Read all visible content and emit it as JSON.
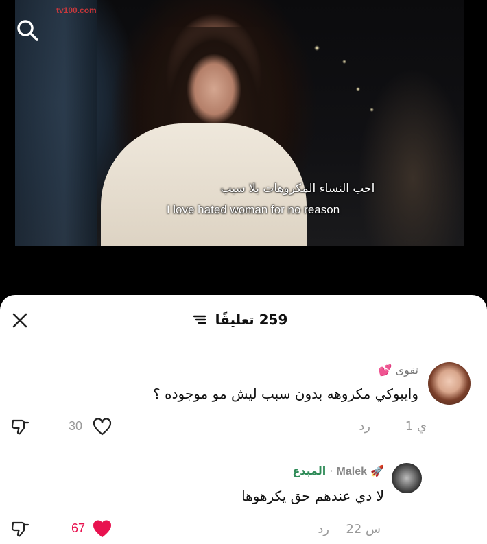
{
  "video": {
    "watermark": "tv100.com",
    "subtitle_ar": "احب النساء المكروهات بلا سبب",
    "subtitle_en": "I love hated woman for no reason"
  },
  "sheet": {
    "count": "259",
    "title_word": "تعليقًا"
  },
  "comments": [
    {
      "author": "تقوى",
      "author_emoji": "💕",
      "text": "وايبوكي مكروهه بدون سبب ليش مو موجوده ؟",
      "time": "1 ي",
      "reply": "رد",
      "likes": "30",
      "liked": false
    },
    {
      "author": "Malek",
      "author_emoji": "🚀",
      "tag": "المبدع",
      "separator": "·",
      "text": "لا دي عندهم حق يكرهوها",
      "time": "22 س",
      "reply": "رد",
      "likes": "67",
      "liked": true
    }
  ],
  "colors": {
    "like_active": "#e8124f",
    "tag": "#2e8b57",
    "muted": "#999999"
  }
}
